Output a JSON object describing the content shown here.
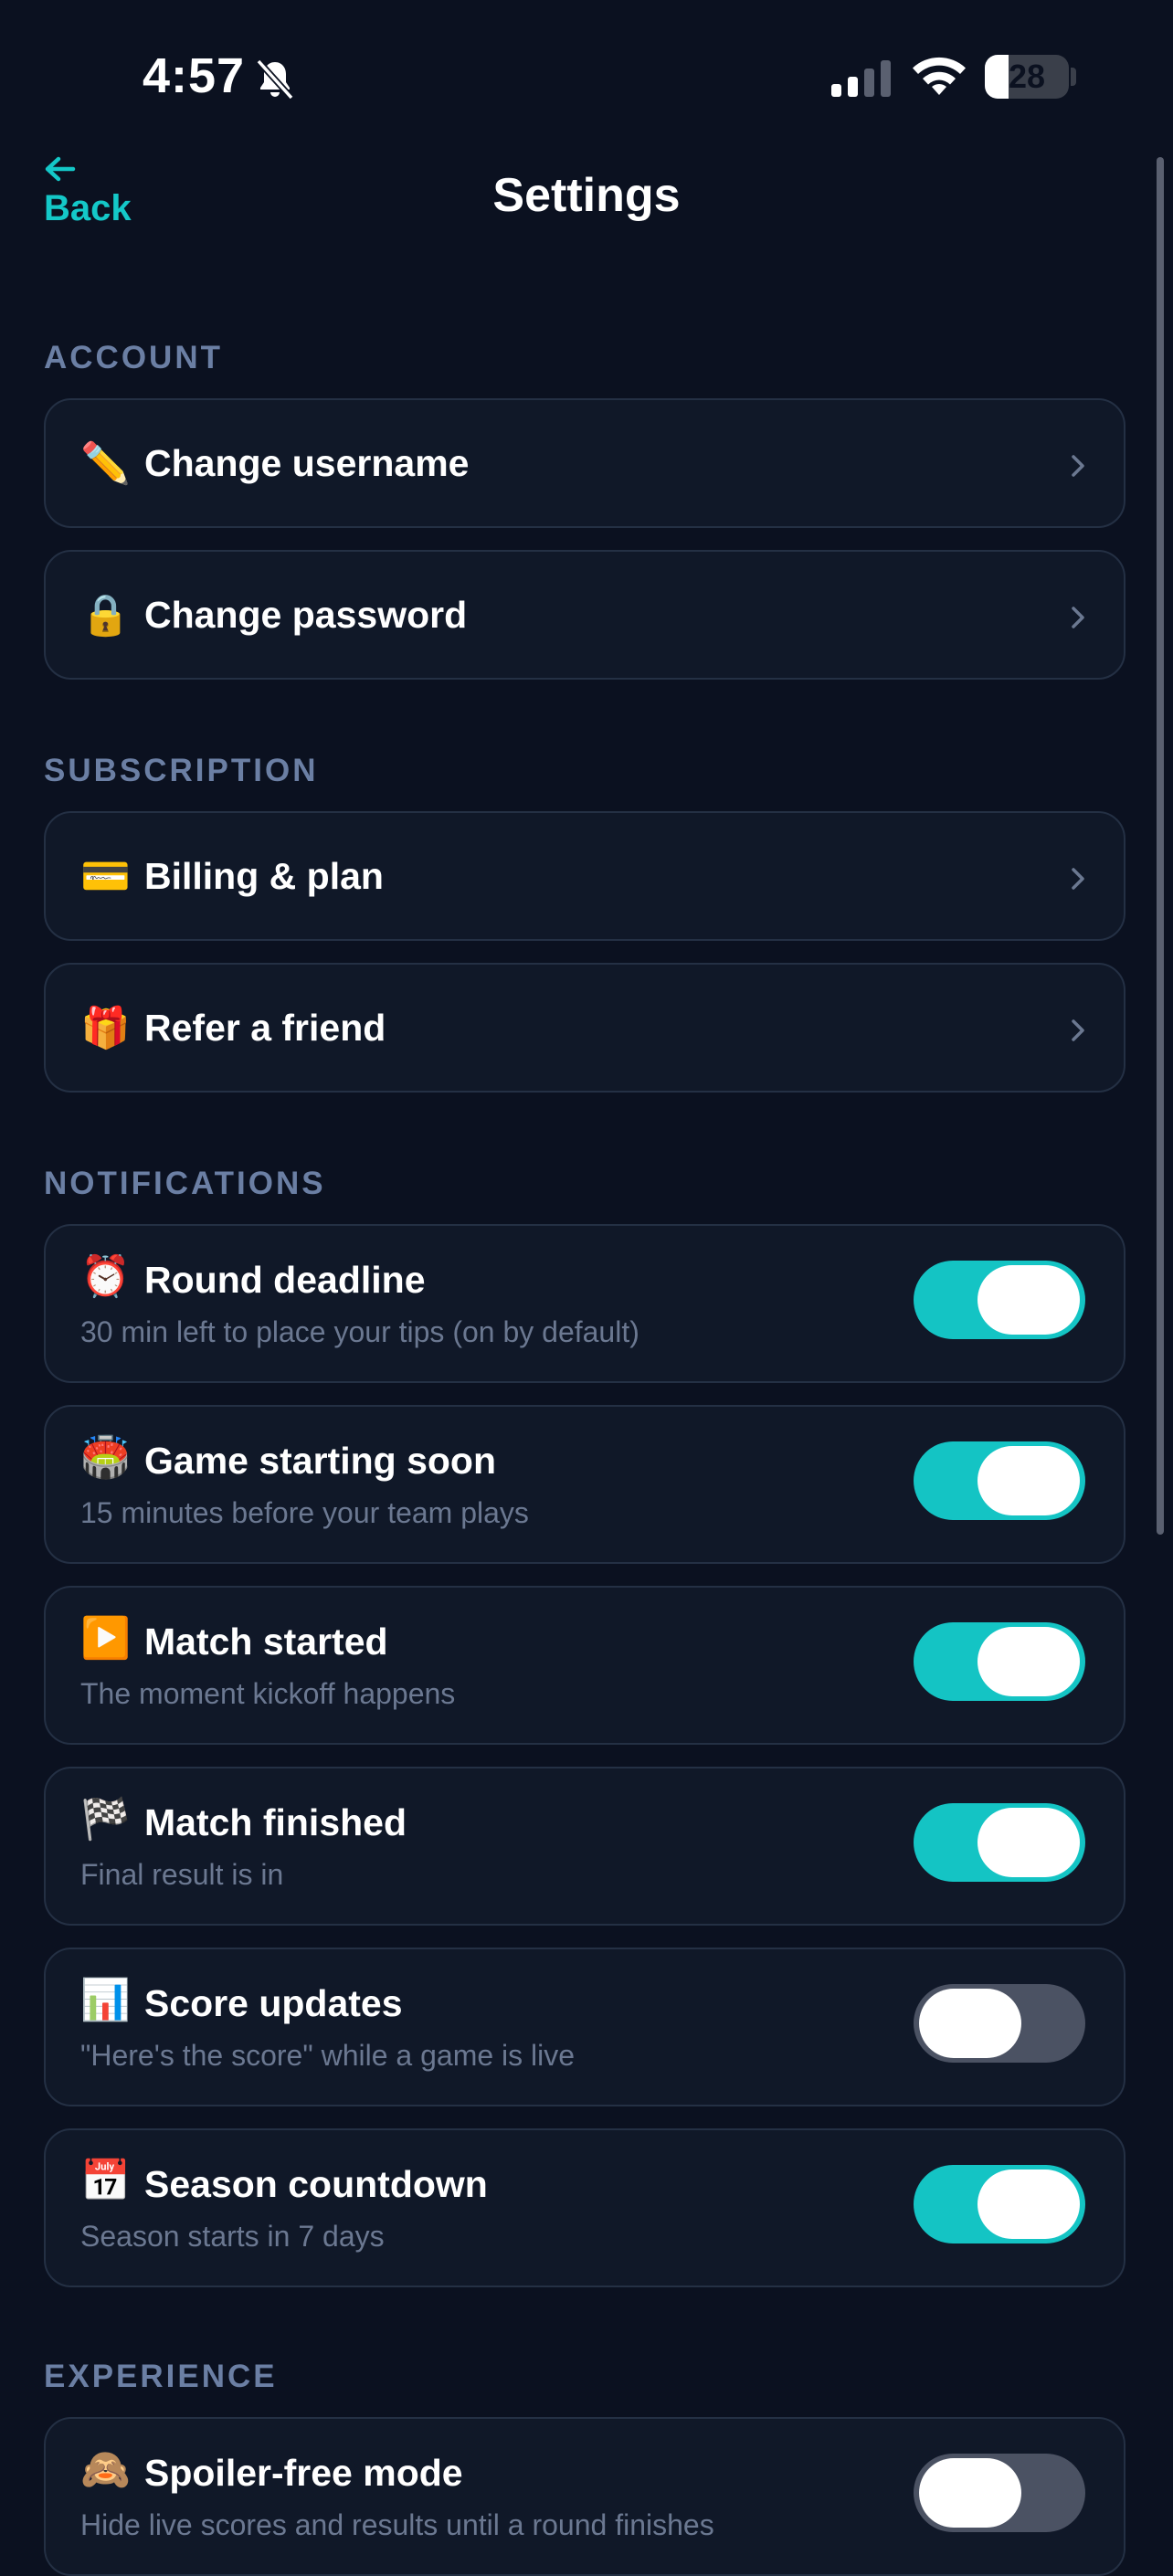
{
  "status_bar": {
    "time": "4:57",
    "battery": "28",
    "battery_level": 0.28
  },
  "header": {
    "back_label": "Back",
    "title": "Settings"
  },
  "sections": {
    "account": {
      "title": "ACCOUNT",
      "items": [
        {
          "emoji": "✏️",
          "label": "Change username"
        },
        {
          "emoji": "🔒",
          "label": "Change password"
        }
      ]
    },
    "subscription": {
      "title": "SUBSCRIPTION",
      "items": [
        {
          "emoji": "💳",
          "label": "Billing & plan"
        },
        {
          "emoji": "🎁",
          "label": "Refer a friend"
        }
      ]
    },
    "notifications": {
      "title": "NOTIFICATIONS",
      "items": [
        {
          "emoji": "⏰",
          "label": "Round deadline",
          "sub": "30 min left to place your tips (on by default)",
          "on": true
        },
        {
          "emoji": "🏟️",
          "label": "Game starting soon",
          "sub": "15 minutes before your team plays",
          "on": true
        },
        {
          "emoji": "▶️",
          "label": "Match started",
          "sub": "The moment kickoff happens",
          "on": true
        },
        {
          "emoji": "🏁",
          "label": "Match finished",
          "sub": "Final result is in",
          "on": true
        },
        {
          "emoji": "📊",
          "label": "Score updates",
          "sub": "\"Here's the score\" while a game is live",
          "on": false
        },
        {
          "emoji": "📅",
          "label": "Season countdown",
          "sub": "Season starts in 7 days",
          "on": true
        }
      ]
    },
    "experience": {
      "title": "EXPERIENCE",
      "items": [
        {
          "emoji": "🙈",
          "label": "Spoiler-free mode",
          "sub": "Hide live scores and results until a round finishes",
          "on": false
        }
      ]
    }
  },
  "colors": {
    "background": "#0b1120",
    "accent": "#14c8c8",
    "card": "#101828",
    "section_title": "#6b7fa4",
    "toggle_off": "#4b5263"
  }
}
